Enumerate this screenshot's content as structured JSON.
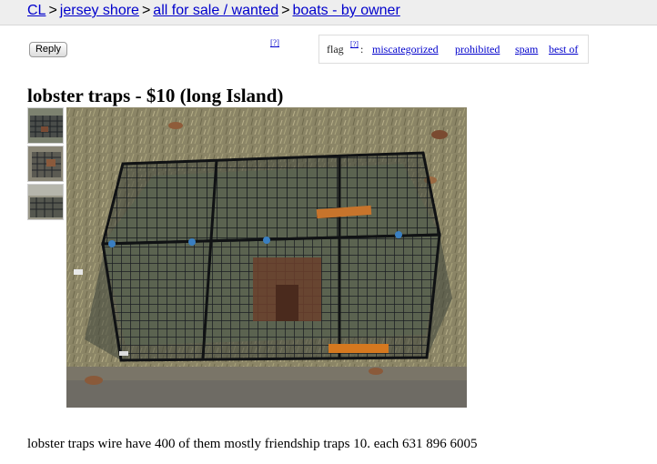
{
  "breadcrumb": {
    "items": [
      "CL",
      "jersey shore",
      "all for sale / wanted",
      "boats - by owner"
    ],
    "separator": ">"
  },
  "actions": {
    "reply_label": "Reply",
    "help_marker": "[?]"
  },
  "flag": {
    "label": "flag",
    "help_marker": "[?]",
    "colon": ":",
    "options": [
      "miscategorized",
      "prohibited",
      "spam",
      "best of"
    ]
  },
  "posting": {
    "title": "lobster traps - $10 (long Island)",
    "body": "lobster traps wire have 400 of them mostly friendship traps 10. each 631 896 6005",
    "image_count": 3
  },
  "colors": {
    "link": "#0000cc",
    "header_bg": "#eeeeee"
  }
}
